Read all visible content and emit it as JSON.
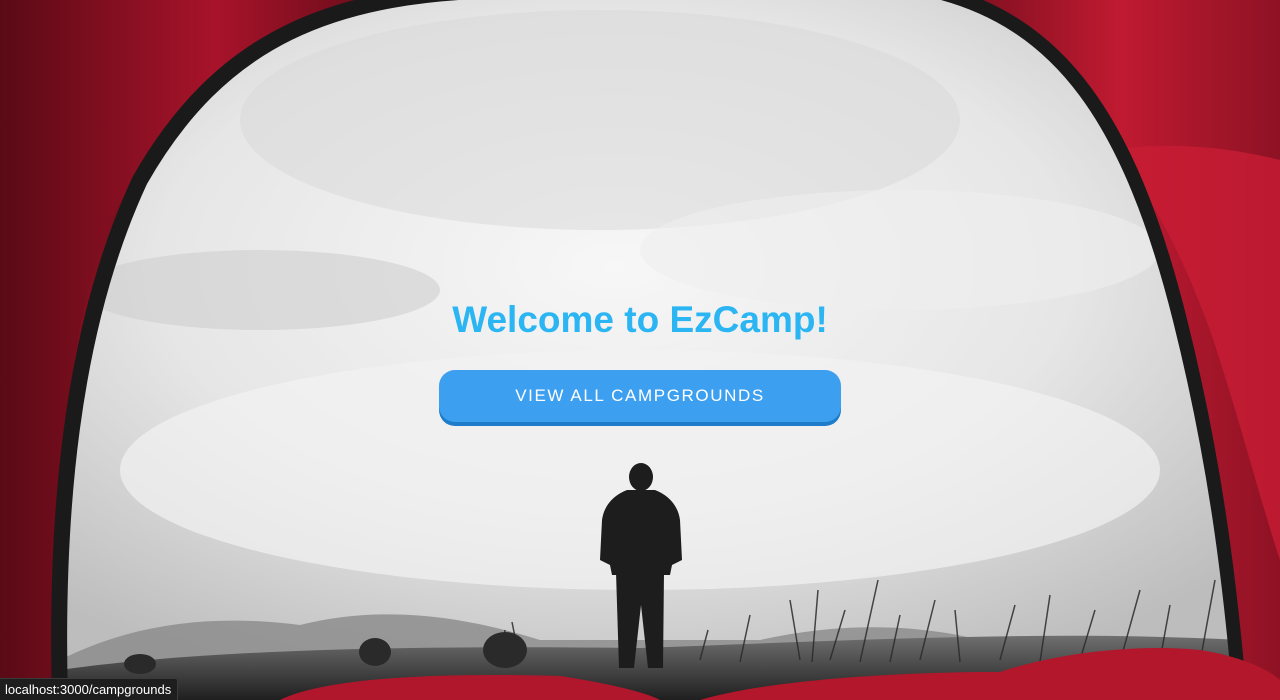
{
  "hero": {
    "title": "Welcome to EzCamp!",
    "cta_label": "VIEW ALL CAMPGROUNDS",
    "title_color": "#2bb5f2",
    "cta_color": "#3d9ff0"
  },
  "status_bar": {
    "hover_url": "localhost:3000/campgrounds"
  },
  "background": {
    "scene": "tent-opening-foggy-landscape",
    "tent_color": "#b3172c"
  }
}
